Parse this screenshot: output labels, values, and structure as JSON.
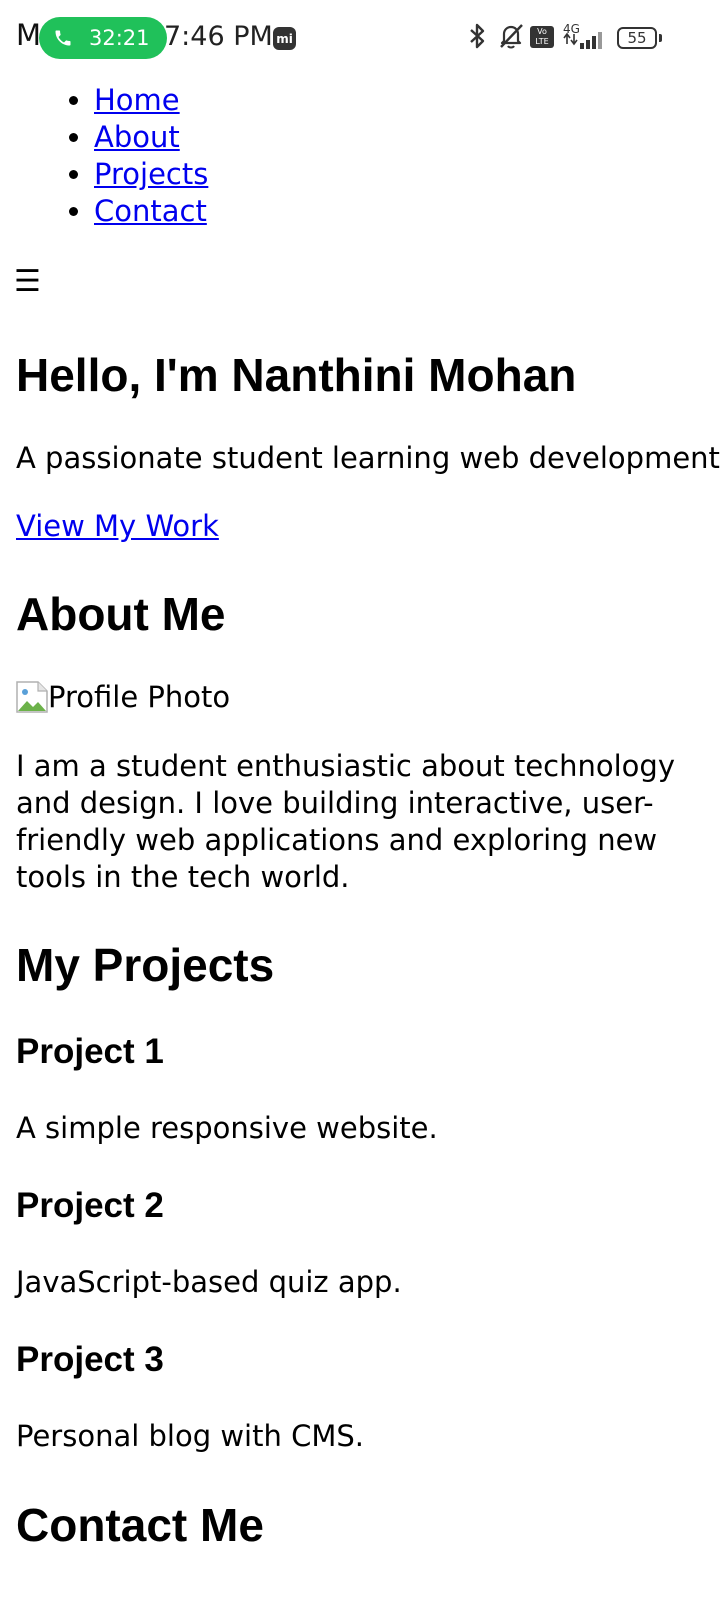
{
  "status_bar": {
    "carrier": "M",
    "call_timer": "32:21",
    "clock": "7:46 PM",
    "mi_badge": "mi",
    "volte": "Vo LTE",
    "network": "4G",
    "battery": "55"
  },
  "nav": {
    "items": [
      {
        "label": "Home"
      },
      {
        "label": "About"
      },
      {
        "label": "Projects"
      },
      {
        "label": "Contact"
      }
    ],
    "menu_icon": "☰"
  },
  "hero": {
    "title": "Hello, I'm Nanthini Mohan",
    "subtitle": "A passionate student learning web development",
    "cta": "View My Work"
  },
  "about": {
    "title": "About Me",
    "image_alt": "Profile Photo",
    "text": "I am a student enthusiastic about technology and design. I love building interactive, user-friendly web applications and exploring new tools in the tech world."
  },
  "projects": {
    "title": "My Projects",
    "items": [
      {
        "title": "Project 1",
        "description": "A simple responsive website."
      },
      {
        "title": "Project 2",
        "description": "JavaScript-based quiz app."
      },
      {
        "title": "Project 3",
        "description": "Personal blog with CMS."
      }
    ]
  },
  "contact": {
    "title": "Contact Me"
  },
  "colors": {
    "link": "#0000ee",
    "call_pill": "#20c15a",
    "text": "#000000"
  }
}
